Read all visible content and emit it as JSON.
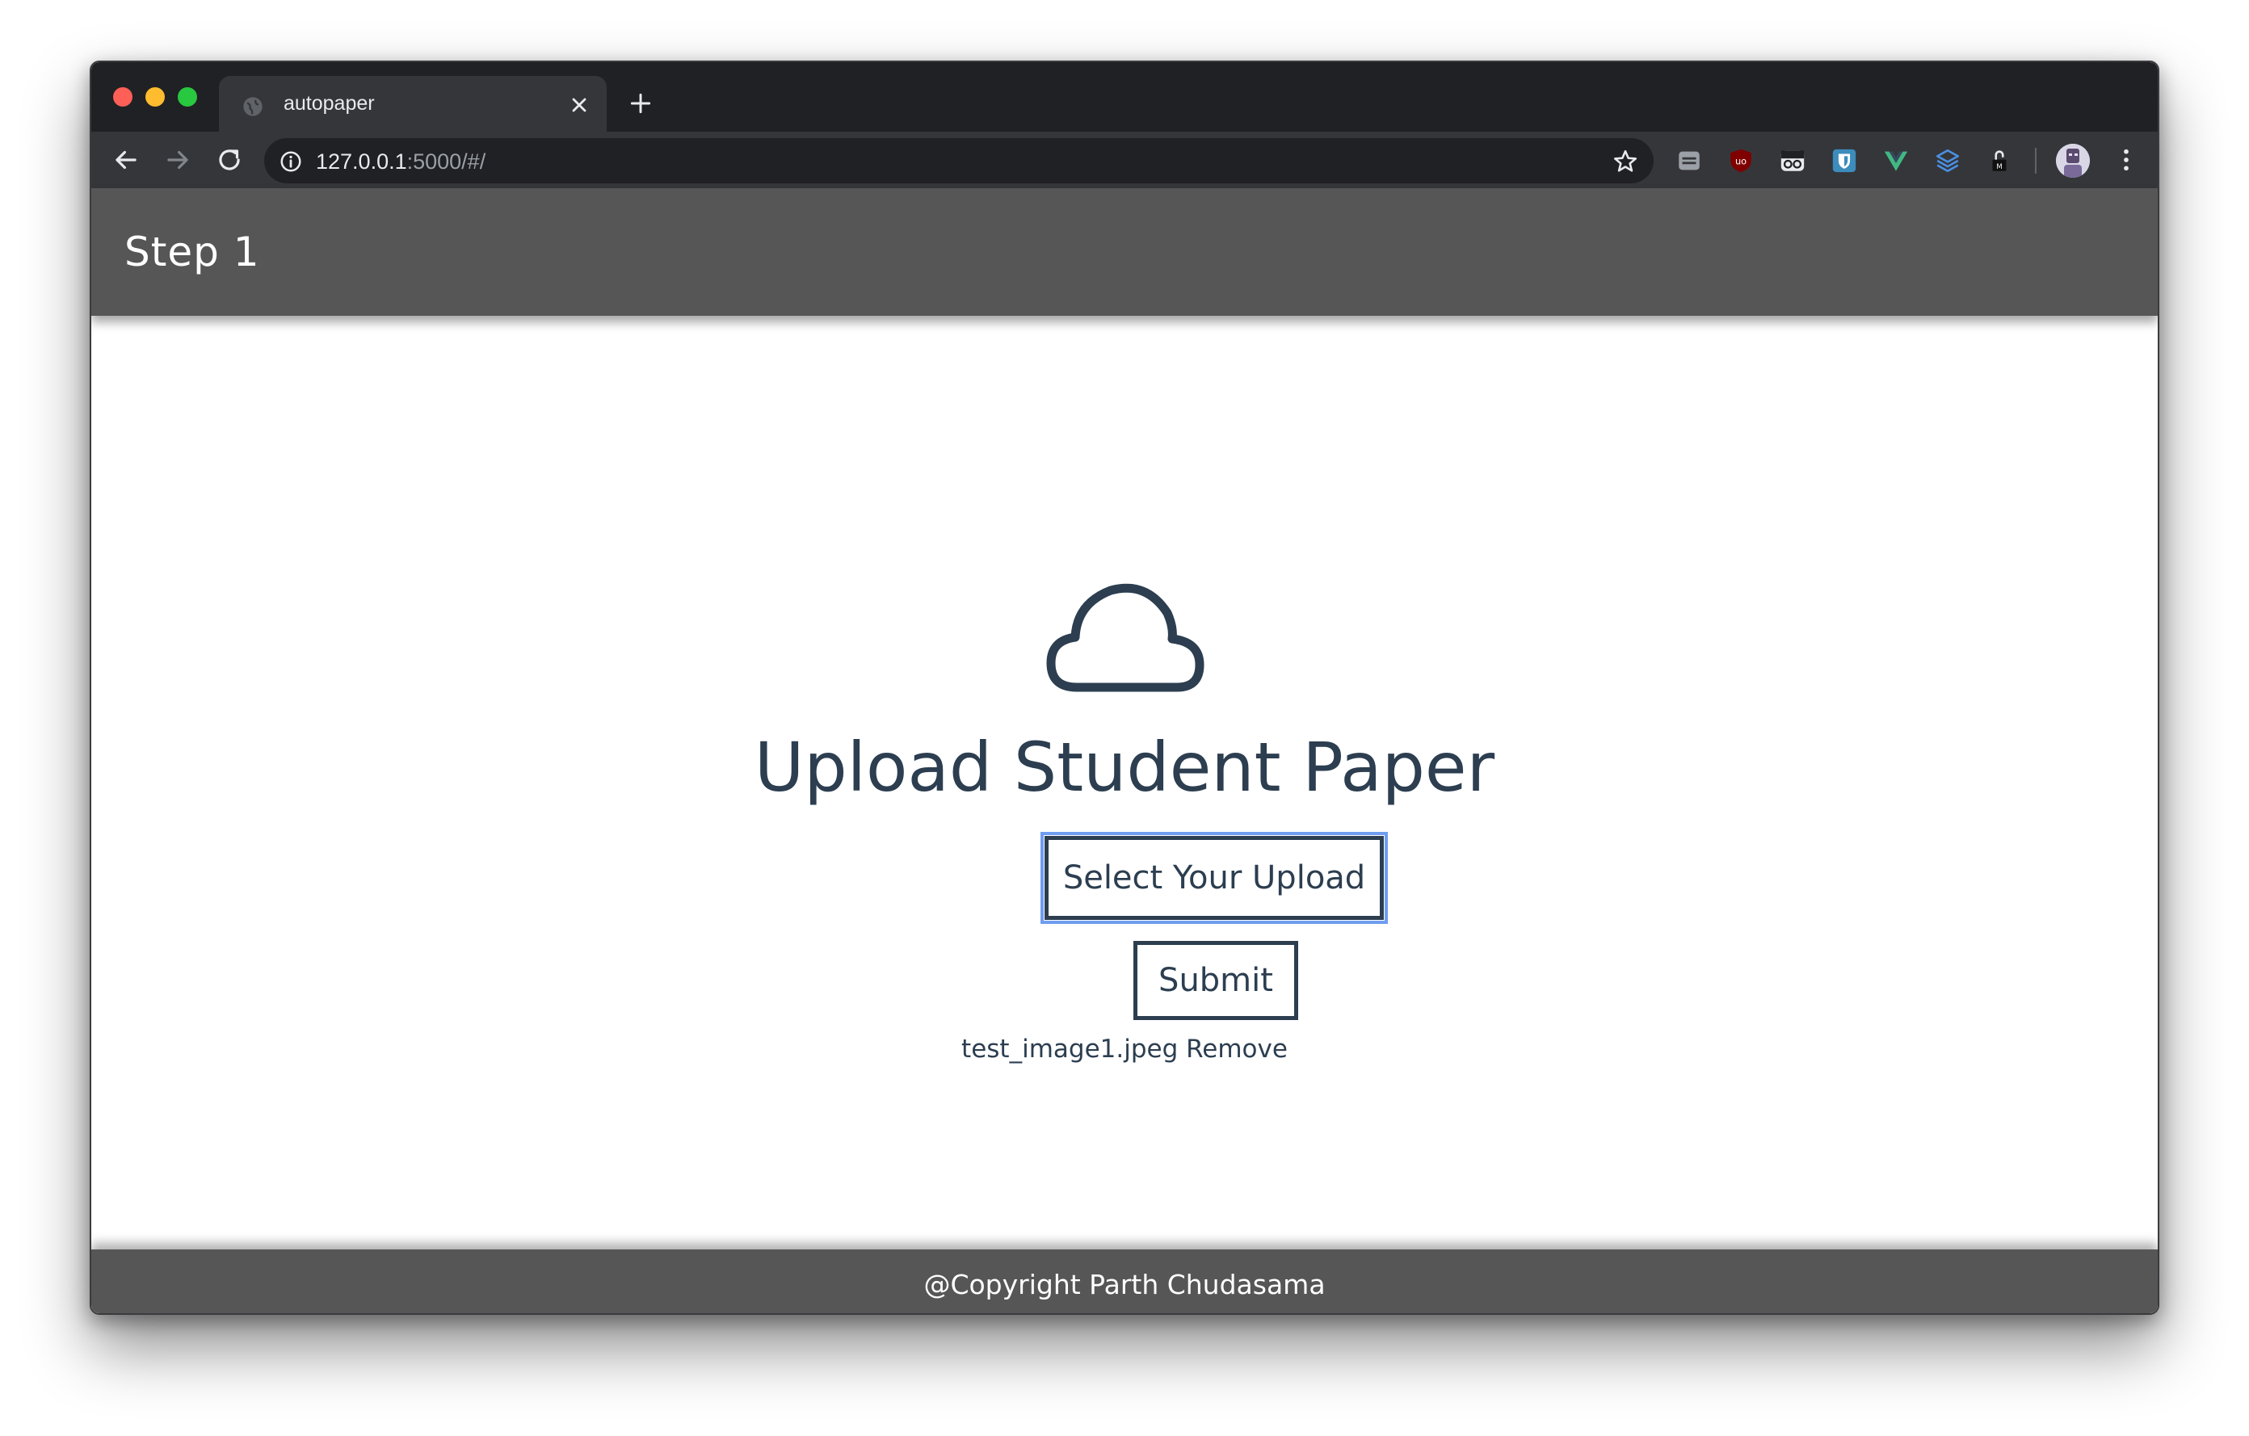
{
  "browser": {
    "tab_title": "autopaper",
    "url_host": "127.0.0.1",
    "url_rest": ":5000/#/",
    "icons": [
      "globe-icon",
      "close-icon",
      "plus-icon",
      "back-arrow-icon",
      "forward-arrow-icon",
      "reload-icon",
      "info-icon",
      "star-icon",
      "menu-icon"
    ],
    "extensions": [
      "tab-extension-icon",
      "ublock-icon",
      "glasses-extension-icon",
      "bitwarden-icon",
      "vue-devtools-icon",
      "layers-extension-icon",
      "lock-extension-icon"
    ]
  },
  "app": {
    "header_title": "Step 1",
    "upload_title": "Upload Student Paper",
    "select_button": "Select Your Upload",
    "submit_button": "Submit",
    "file_name": "test_image1.jpeg",
    "remove_label": "Remove",
    "footer": "@Copyright Parth Chudasama"
  },
  "colors": {
    "header_bg": "#565656",
    "text_primary": "#2c3e50",
    "focus_ring": "#6f9df0",
    "browser_chrome": "#202124"
  }
}
